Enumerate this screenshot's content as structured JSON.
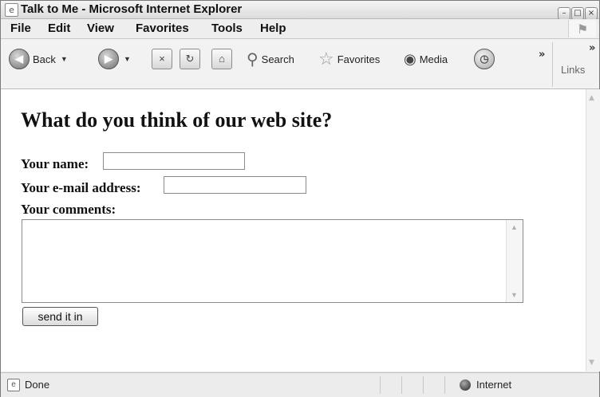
{
  "window": {
    "title": "Talk to Me - Microsoft Internet Explorer"
  },
  "menu": [
    "File",
    "Edit",
    "View",
    "Favorites",
    "Tools",
    "Help"
  ],
  "toolbar": {
    "back_label": "Back",
    "search_label": "Search",
    "favorites_label": "Favorites",
    "media_label": "Media",
    "links_label": "Links"
  },
  "page": {
    "heading": "What do you think of our web site?",
    "name_label": "Your name:",
    "name_value": "",
    "email_label": "Your e-mail address:",
    "email_value": "",
    "comments_label": "Your comments:",
    "comments_value": "",
    "submit_label": "send it in"
  },
  "status": {
    "text": "Done",
    "zone": "Internet"
  }
}
